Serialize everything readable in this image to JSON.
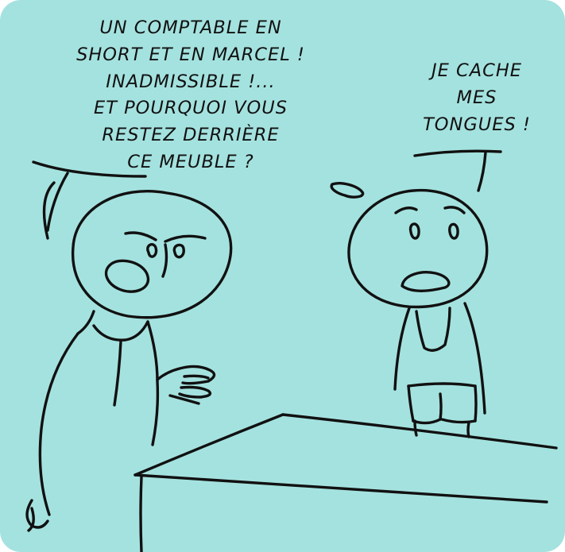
{
  "panel": {
    "background_color": "#A4E2DF",
    "ink_color": "#111111"
  },
  "speech_left": {
    "lines": [
      "UN COMPTABLE EN",
      "SHORT ET EN MARCEL !",
      "INADMISSIBLE !...",
      "ET POURQUOI VOUS",
      "RESTEZ DERRIÈRE",
      "CE MEUBLE ?"
    ]
  },
  "speech_right": {
    "lines": [
      "JE CACHE",
      "MES",
      "TONGUES !"
    ]
  }
}
